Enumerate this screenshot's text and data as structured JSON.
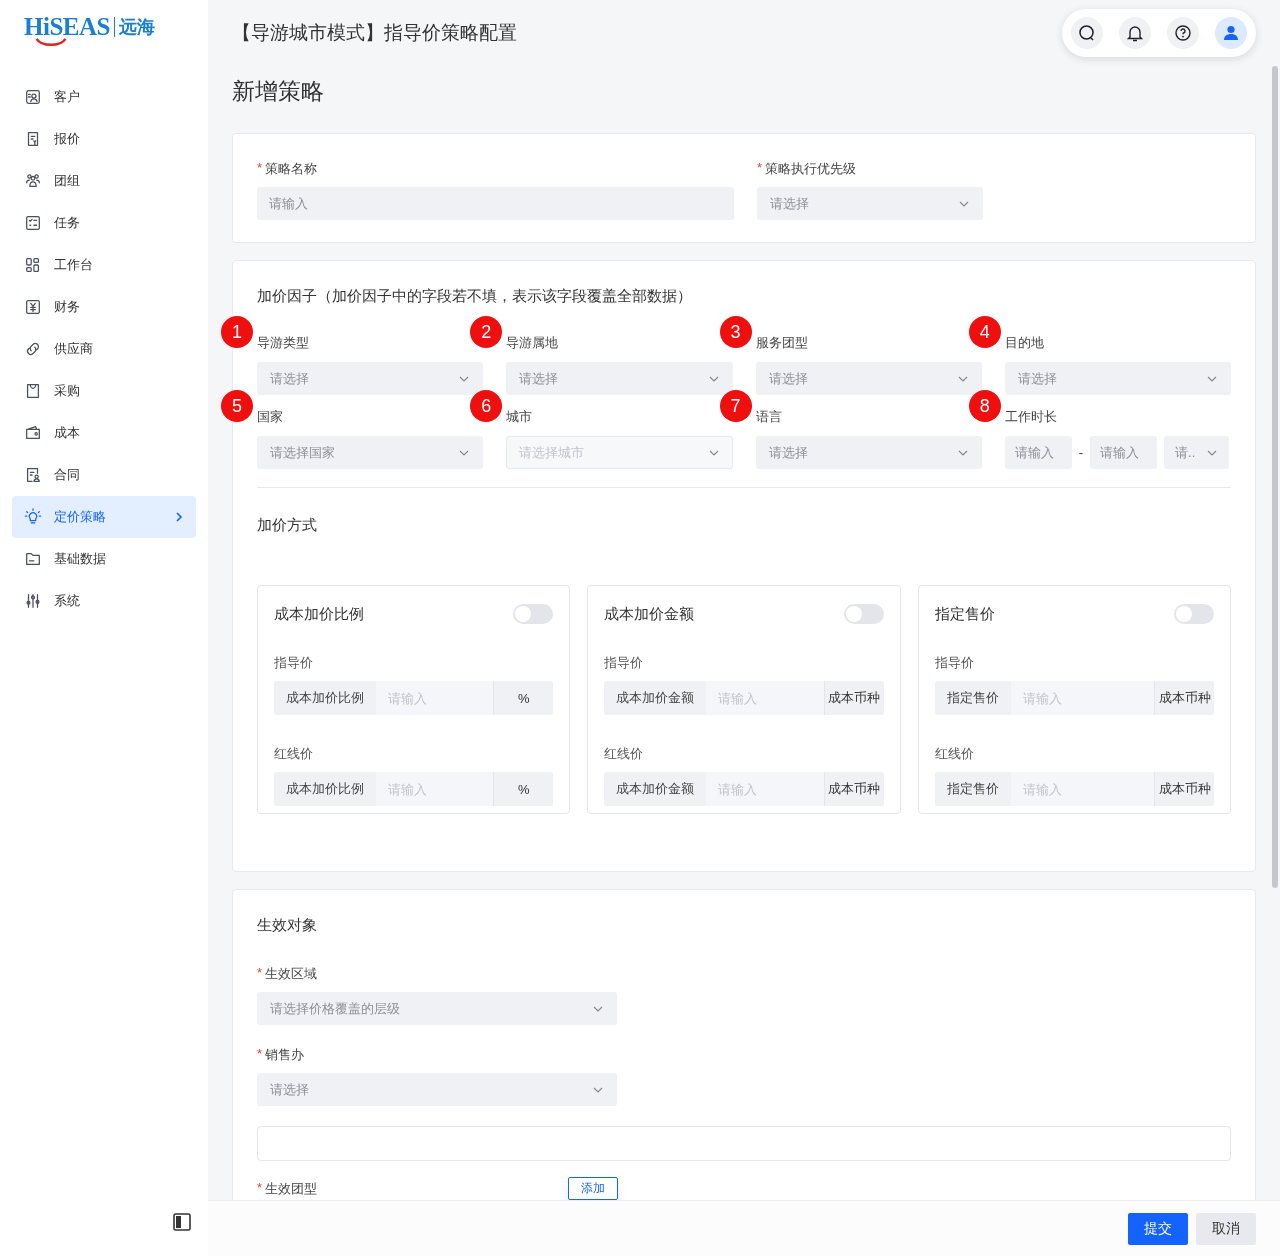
{
  "sidebar": {
    "logo": {
      "brand": "HiSEAS",
      "name": "远海"
    },
    "items": [
      {
        "label": "客户",
        "selected": false
      },
      {
        "label": "报价",
        "selected": false
      },
      {
        "label": "团组",
        "selected": false
      },
      {
        "label": "任务",
        "selected": false
      },
      {
        "label": "工作台",
        "selected": false
      },
      {
        "label": "财务",
        "selected": false
      },
      {
        "label": "供应商",
        "selected": false
      },
      {
        "label": "采购",
        "selected": false
      },
      {
        "label": "成本",
        "selected": false
      },
      {
        "label": "合同",
        "selected": false
      },
      {
        "label": "定价策略",
        "selected": true
      },
      {
        "label": "基础数据",
        "selected": false
      },
      {
        "label": "系统",
        "selected": false
      }
    ]
  },
  "header": {
    "title": "【导游城市模式】指导价策略配置"
  },
  "page_title": "新增策略",
  "basic": {
    "fields": [
      {
        "kind": "input",
        "mark": "*",
        "label": "策略名称",
        "placeholder": "请输入"
      },
      {
        "kind": "select",
        "mark": "*",
        "label": "策略执行优先级",
        "placeholder": "请选择"
      }
    ]
  },
  "factors": {
    "title": "加价因子（加价因子中的字段若不填，表示该字段覆盖全部数据）",
    "fields": [
      {
        "kind": "select",
        "marker": "1",
        "label": "导游类型",
        "placeholder": "请选择",
        "disabled": false
      },
      {
        "kind": "select",
        "marker": "2",
        "label": "导游属地",
        "placeholder": "请选择",
        "disabled": false
      },
      {
        "kind": "select",
        "marker": "3",
        "label": "服务团型",
        "placeholder": "请选择",
        "disabled": false
      },
      {
        "kind": "select",
        "marker": "4",
        "label": "目的地",
        "placeholder": "请选择",
        "disabled": false
      },
      {
        "kind": "select",
        "marker": "5",
        "label": "国家",
        "placeholder": "请选择国家",
        "disabled": false
      },
      {
        "kind": "select",
        "marker": "6",
        "label": "城市",
        "placeholder": "请选择城市",
        "disabled": true
      },
      {
        "kind": "select",
        "marker": "7",
        "label": "语言",
        "placeholder": "请选择",
        "disabled": false
      },
      {
        "kind": "range",
        "marker": "8",
        "label": "工作时长",
        "inputs": [
          {
            "placeholder": "请输入"
          },
          {
            "placeholder": "请输入"
          }
        ],
        "separator": "-",
        "unit": "请.."
      }
    ]
  },
  "markup": {
    "title": "加价方式",
    "options": [
      {
        "title": "成本加价比例",
        "on": false,
        "rows": [
          {
            "label": "指导价",
            "prefix": "成本加价比例",
            "placeholder": "请输入",
            "suffix": "%"
          },
          {
            "label": "红线价",
            "prefix": "成本加价比例",
            "placeholder": "请输入",
            "suffix": "%"
          }
        ]
      },
      {
        "title": "成本加价金额",
        "on": false,
        "rows": [
          {
            "label": "指导价",
            "prefix": "成本加价金额",
            "placeholder": "请输入",
            "suffix": "成本币种"
          },
          {
            "label": "红线价",
            "prefix": "成本加价金额",
            "placeholder": "请输入",
            "suffix": "成本币种"
          }
        ]
      },
      {
        "title": "指定售价",
        "on": false,
        "rows": [
          {
            "label": "指导价",
            "prefix": "指定售价",
            "placeholder": "请输入",
            "suffix": "成本币种"
          },
          {
            "label": "红线价",
            "prefix": "指定售价",
            "placeholder": "请输入",
            "suffix": "成本币种"
          }
        ]
      }
    ]
  },
  "scope": {
    "title": "生效对象",
    "fields": [
      {
        "kind": "select",
        "mark": "*",
        "label": "生效区域",
        "placeholder": "请选择价格覆盖的层级"
      },
      {
        "kind": "select",
        "mark": "*",
        "label": "销售办",
        "placeholder": "请选择"
      },
      {
        "kind": "box"
      },
      {
        "kind": "add",
        "mark": "*",
        "label": "生效团型",
        "button": "添加"
      }
    ]
  },
  "footer": {
    "buttons": [
      {
        "label": "提交",
        "primary": true
      },
      {
        "label": "取消",
        "primary": false
      }
    ]
  }
}
